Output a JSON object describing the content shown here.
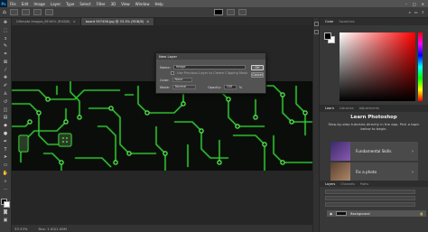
{
  "menubar": {
    "logo": "Ps",
    "items": [
      "File",
      "Edit",
      "Image",
      "Layer",
      "Type",
      "Select",
      "Filter",
      "3D",
      "View",
      "Window",
      "Help"
    ]
  },
  "tabs": [
    {
      "label": "Ultimate Images_BF.60% (RGB/8)",
      "active": false
    },
    {
      "label": "board 957456.jpg @ 33.3% (RGB/8)",
      "active": true
    }
  ],
  "dialog": {
    "title": "New Layer",
    "name_label": "Name:",
    "name_value": "Image",
    "clip_text": "Use Previous Layer to Create Clipping Mask",
    "color_label": "Color:",
    "color_value": "None",
    "mode_label": "Mode:",
    "mode_value": "Normal",
    "opacity_label": "Opacity:",
    "opacity_value": "100",
    "opacity_unit": "%",
    "ok_label": "OK",
    "cancel_label": "Cancel"
  },
  "status": {
    "zoom": "33.33%",
    "doc": "Doc: 1.00/1.00M"
  },
  "panels": {
    "color_tabs": [
      "Color",
      "Swatches"
    ],
    "learn_tabs": [
      "Learn",
      "Libraries",
      "Adjustments"
    ],
    "learn_title": "Learn Photoshop",
    "learn_desc": "Step-by-step tutorials directly in the app. Pick a topic below to begin.",
    "cards": [
      {
        "label": "Fundamental Skills",
        "thumb_color": "#5a3a8a"
      },
      {
        "label": "Fix a photo",
        "thumb_color": "#7a5a3a"
      }
    ],
    "layers_tabs": [
      "Layers",
      "Channels",
      "Paths"
    ],
    "layer_name": "Background"
  },
  "colors": {
    "accent": "#31a8ff",
    "circuit_trace": "#39e23a"
  }
}
